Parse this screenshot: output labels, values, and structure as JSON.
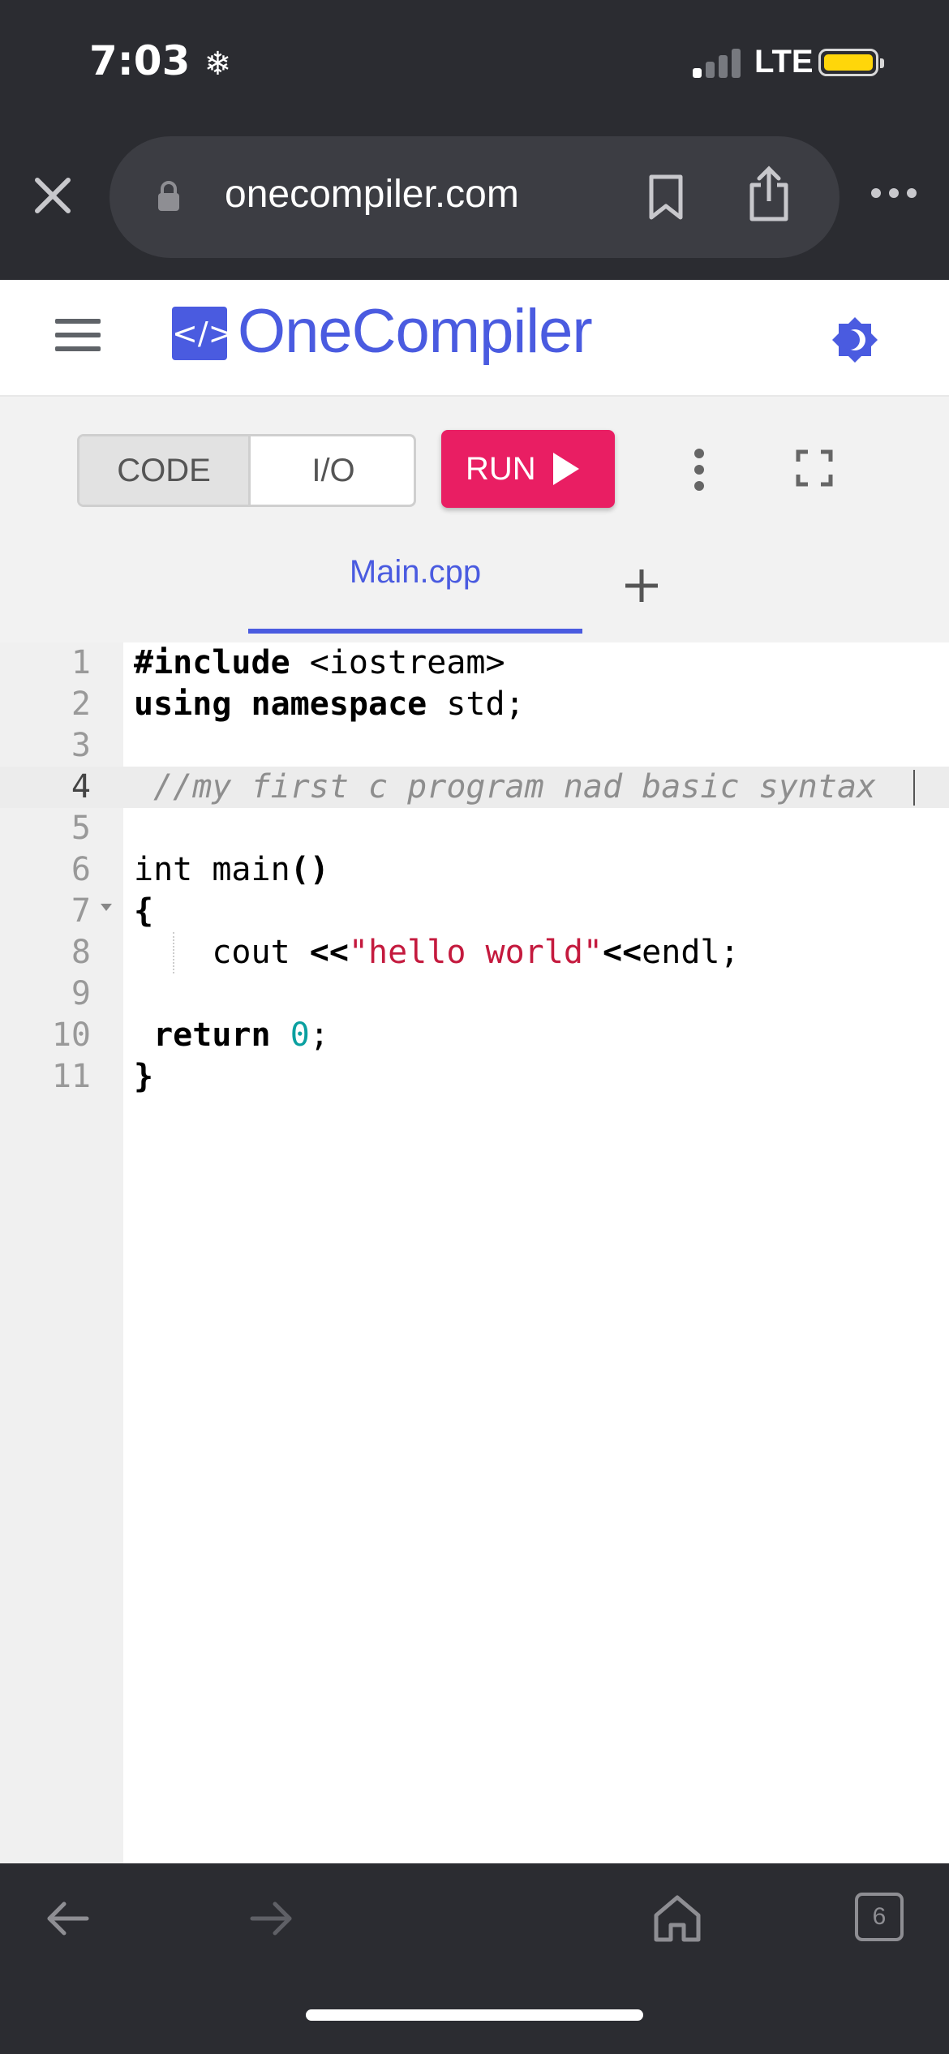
{
  "status_bar": {
    "time": "7:03",
    "network": "LTE"
  },
  "browser": {
    "url": "onecompiler.com"
  },
  "app": {
    "brand": "OneCompiler",
    "logo_symbol": "</>"
  },
  "toolbar": {
    "code_label": "CODE",
    "io_label": "I/O",
    "run_label": "RUN",
    "active_mode": "CODE"
  },
  "tabs": [
    {
      "label": "Main.cpp",
      "active": true
    }
  ],
  "editor": {
    "lines": [
      {
        "n": "1",
        "text": "#include <iostream>"
      },
      {
        "n": "2",
        "text": "using namespace std;"
      },
      {
        "n": "3",
        "text": ""
      },
      {
        "n": "4",
        "text": " //my first c program nad basic syntax"
      },
      {
        "n": "5",
        "text": ""
      },
      {
        "n": "6",
        "text": "int main()"
      },
      {
        "n": "7",
        "text": "{"
      },
      {
        "n": "8",
        "text": "    cout <<\"hello world\"<<endl;"
      },
      {
        "n": "9",
        "text": ""
      },
      {
        "n": "10",
        "text": " return 0;"
      },
      {
        "n": "11",
        "text": "}"
      }
    ],
    "active_line": 4
  },
  "bottom_bar": {
    "tab_count": "6"
  },
  "colors": {
    "accent": "#4a5be0",
    "run_button": "#e91e63",
    "battery": "#ffd60a",
    "string": "#c41a3e",
    "number": "#0aa0a0",
    "comment": "#8e8e8e"
  },
  "icons": [
    "close-icon",
    "lock-icon",
    "bookmark-icon",
    "share-icon",
    "more-icon",
    "hamburger-menu-icon",
    "theme-toggle-icon",
    "play-icon",
    "kebab-menu-icon",
    "fullscreen-icon",
    "plus-icon",
    "back-arrow-icon",
    "forward-arrow-icon",
    "home-icon",
    "tabs-icon"
  ]
}
